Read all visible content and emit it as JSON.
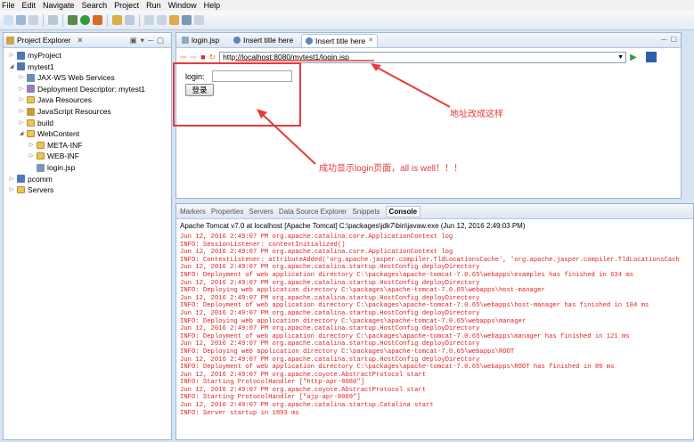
{
  "menu": [
    "File",
    "Edit",
    "Navigate",
    "Search",
    "Project",
    "Run",
    "Window",
    "Help"
  ],
  "explorer": {
    "title": "Project Explorer",
    "items": [
      {
        "label": "myProject",
        "indent": 0,
        "kind": "project",
        "arrow": "▷"
      },
      {
        "label": "mytest1",
        "indent": 0,
        "kind": "project",
        "arrow": "◢"
      },
      {
        "label": "JAX-WS Web Services",
        "indent": 1,
        "kind": "ws",
        "arrow": "▷"
      },
      {
        "label": "Deployment Descriptor: mytest1",
        "indent": 1,
        "kind": "dd",
        "arrow": "▷"
      },
      {
        "label": "Java Resources",
        "indent": 1,
        "kind": "folder",
        "arrow": "▷"
      },
      {
        "label": "JavaScript Resources",
        "indent": 1,
        "kind": "js",
        "arrow": "▷"
      },
      {
        "label": "build",
        "indent": 1,
        "kind": "folder",
        "arrow": "▷"
      },
      {
        "label": "WebContent",
        "indent": 1,
        "kind": "folder",
        "arrow": "◢"
      },
      {
        "label": "META-INF",
        "indent": 2,
        "kind": "folder",
        "arrow": "▷"
      },
      {
        "label": "WEB-INF",
        "indent": 2,
        "kind": "folder",
        "arrow": "▷"
      },
      {
        "label": "login.jsp",
        "indent": 2,
        "kind": "file",
        "arrow": ""
      },
      {
        "label": "pcomm",
        "indent": 0,
        "kind": "project",
        "arrow": "▷"
      },
      {
        "label": "Servers",
        "indent": 0,
        "kind": "folder",
        "arrow": "▷"
      }
    ]
  },
  "editor": {
    "tabs": [
      "login.jsp",
      "Insert title here",
      "Insert title here"
    ],
    "url": "http://localhost:8080/mytest1/login.jsp",
    "login_label": "login:",
    "login_button": "登录"
  },
  "annotations": {
    "url_note": "地址改成这样",
    "success_note": "成功显示login页面，all is well！！！"
  },
  "console": {
    "tabs": [
      "Markers",
      "Properties",
      "Servers",
      "Data Source Explorer",
      "Snippets",
      "Console"
    ],
    "description": "Apache Tomcat v7.0  at localhost [Apache Tomcat] C:\\packages\\jdk7\\bin\\javaw.exe (Jun 12, 2016 2:49:03 PM)",
    "lines": [
      "Jun 12, 2016 2:49:07 PM org.apache.catalina.core.ApplicationContext log",
      "INFO: SessionListener: contextInitialized()",
      "Jun 12, 2016 2:49:07 PM org.apache.catalina.core.ApplicationContext log",
      "INFO: ContextListener: attributeAdded('org.apache.jasper.compiler.TldLocationsCache', 'org.apache.jasper.compiler.TldLocationsCach",
      "Jun 12, 2016 2:49:07 PM org.apache.catalina.startup.HostConfig deployDirectory",
      "INFO: Deployment of web application directory C:\\packages\\apache-tomcat-7.0.65\\webapps\\examples has finished in 634 ms",
      "Jun 12, 2016 2:49:07 PM org.apache.catalina.startup.HostConfig deployDirectory",
      "INFO: Deploying web application directory C:\\packages\\apache-tomcat-7.0.65\\webapps\\host-manager",
      "Jun 12, 2016 2:49:07 PM org.apache.catalina.startup.HostConfig deployDirectory",
      "INFO: Deployment of web application directory C:\\packages\\apache-tomcat-7.0.65\\webapps\\host-manager has finished in 104 ms",
      "Jun 12, 2016 2:49:07 PM org.apache.catalina.startup.HostConfig deployDirectory",
      "INFO: Deploying web application directory C:\\packages\\apache-tomcat-7.0.65\\webapps\\manager",
      "Jun 12, 2016 2:49:07 PM org.apache.catalina.startup.HostConfig deployDirectory",
      "INFO: Deployment of web application directory C:\\packages\\apache-tomcat-7.0.65\\webapps\\manager has finished in 121 ms",
      "Jun 12, 2016 2:49:07 PM org.apache.catalina.startup.HostConfig deployDirectory",
      "INFO: Deploying web application directory C:\\packages\\apache-tomcat-7.0.65\\webapps\\ROOT",
      "Jun 12, 2016 2:49:07 PM org.apache.catalina.startup.HostConfig deployDirectory",
      "INFO: Deployment of web application directory C:\\packages\\apache-tomcat-7.0.65\\webapps\\ROOT has finished in 89 ms",
      "Jun 12, 2016 2:49:07 PM org.apache.coyote.AbstractProtocol start",
      "INFO: Starting ProtocolHandler [\"http-apr-8080\"]",
      "Jun 12, 2016 2:49:07 PM org.apache.coyote.AbstractProtocol start",
      "INFO: Starting ProtocolHandler [\"ajp-apr-8009\"]",
      "Jun 12, 2016 2:49:07 PM org.apache.catalina.startup.Catalina start",
      "INFO: Server startup in 1893 ms"
    ]
  },
  "colors": {
    "annotation": "#e53b3b",
    "log": "#e02222"
  }
}
